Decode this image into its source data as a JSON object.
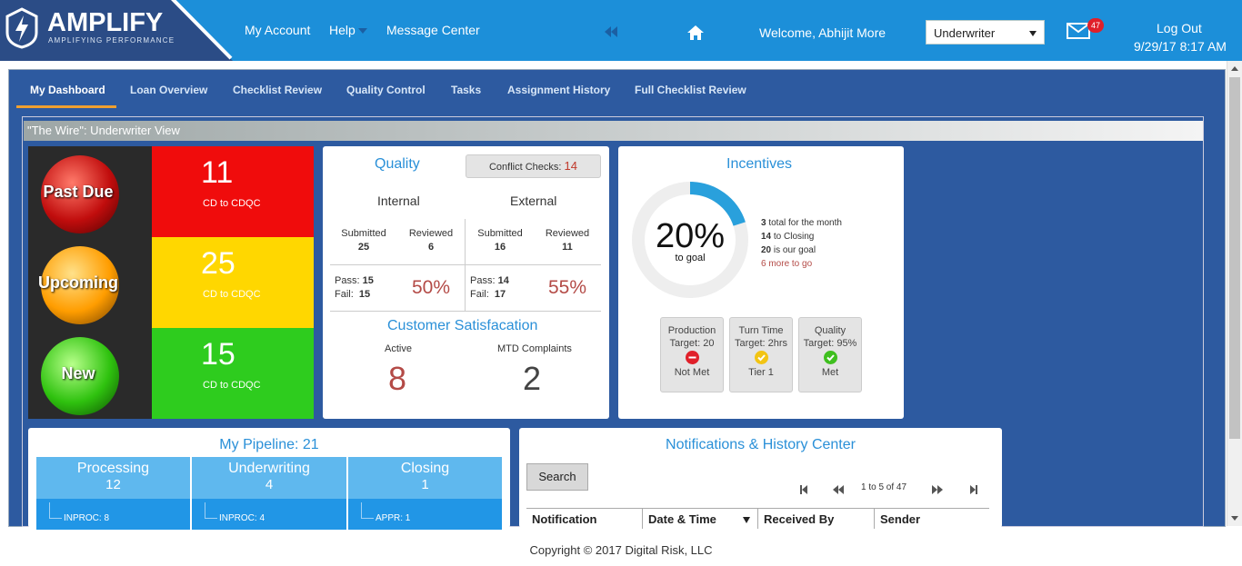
{
  "header": {
    "logo_text": "AMPLIFY",
    "logo_tagline": "AMPLIFYING PERFORMANCE",
    "nav": {
      "my_account": "My Account",
      "help": "Help",
      "message_center": "Message Center"
    },
    "welcome": "Welcome, Abhijit More",
    "role_select": {
      "selected": "Underwriter"
    },
    "mail_count": "47",
    "logout": "Log Out",
    "datetime": "9/29/17 8:17 AM"
  },
  "tabs": [
    {
      "label": "My Dashboard",
      "active": true
    },
    {
      "label": "Loan Overview"
    },
    {
      "label": "Checklist Review"
    },
    {
      "label": "Quality Control"
    },
    {
      "label": "Tasks"
    },
    {
      "label": "Assignment History"
    },
    {
      "label": "Full Checklist Review"
    }
  ],
  "view_title": "\"The Wire\": Underwriter View",
  "traffic": {
    "past_due": {
      "label": "Past Due",
      "count": "11",
      "sub": "CD to CDQC"
    },
    "upcoming": {
      "label": "Upcoming",
      "count": "25",
      "sub": "CD to CDQC"
    },
    "new": {
      "label": "New",
      "count": "15",
      "sub": "CD to CDQC"
    }
  },
  "quality": {
    "title": "Quality",
    "conflict_label": "Conflict Checks:",
    "conflict_value": "14",
    "internal": {
      "title": "Internal",
      "submitted_label": "Submitted",
      "submitted": "25",
      "reviewed_label": "Reviewed",
      "reviewed": "6",
      "pass_label": "Pass:",
      "pass": "15",
      "fail_label": "Fail:",
      "fail": "15",
      "pct": "50%"
    },
    "external": {
      "title": "External",
      "submitted_label": "Submitted",
      "submitted": "16",
      "reviewed_label": "Reviewed",
      "reviewed": "11",
      "pass_label": "Pass:",
      "pass": "14",
      "fail_label": "Fail:",
      "fail": "17",
      "pct": "55%"
    },
    "cs_title": "Customer Satisfacation",
    "active_label": "Active",
    "active_value": "8",
    "mtd_label": "MTD Complaints",
    "mtd_value": "2"
  },
  "incentives": {
    "title": "Incentives",
    "percent": "20%",
    "percent_value": 20,
    "percent_sub": "to goal",
    "lines": [
      {
        "num": "3",
        "text": " total for the month"
      },
      {
        "num": "14",
        "text": " to Closing"
      },
      {
        "num": "20",
        "text": " is our goal"
      },
      {
        "num": "6",
        "text": " more to go"
      }
    ],
    "badges": [
      {
        "title": "Production",
        "target": "Target: 20",
        "status": "Not Met",
        "icon": "minus-circle-icon",
        "color": "#e0202a"
      },
      {
        "title": "Turn Time",
        "target": "Target: 2hrs",
        "status": "Tier 1",
        "icon": "check-circle-icon",
        "color": "#f2c413"
      },
      {
        "title": "Quality",
        "target": "Target: 95%",
        "status": "Met",
        "icon": "check-circle-icon",
        "color": "#3fbf1f"
      }
    ]
  },
  "pipeline": {
    "title": "My Pipeline: 21",
    "columns": [
      {
        "name": "Processing",
        "count": "12",
        "item": "INPROC: 8"
      },
      {
        "name": "Underwriting",
        "count": "4",
        "item": "INPROC: 4"
      },
      {
        "name": "Closing",
        "count": "1",
        "item": "APPR: 1"
      }
    ]
  },
  "notifications": {
    "title": "Notifications & History Center",
    "search_label": "Search",
    "pager_text": "1 to 5 of 47",
    "columns": [
      "Notification",
      "Date & Time",
      "Received By",
      "Sender"
    ]
  },
  "footer": "Copyright © 2017 Digital Risk, LLC",
  "colors": {
    "header_blue": "#1c8fd9",
    "frame_blue": "#2d5aa0",
    "accent_orange": "#f0a030",
    "red": "#f00c0c",
    "yellow": "#ffd700",
    "green": "#2ecc1e"
  }
}
